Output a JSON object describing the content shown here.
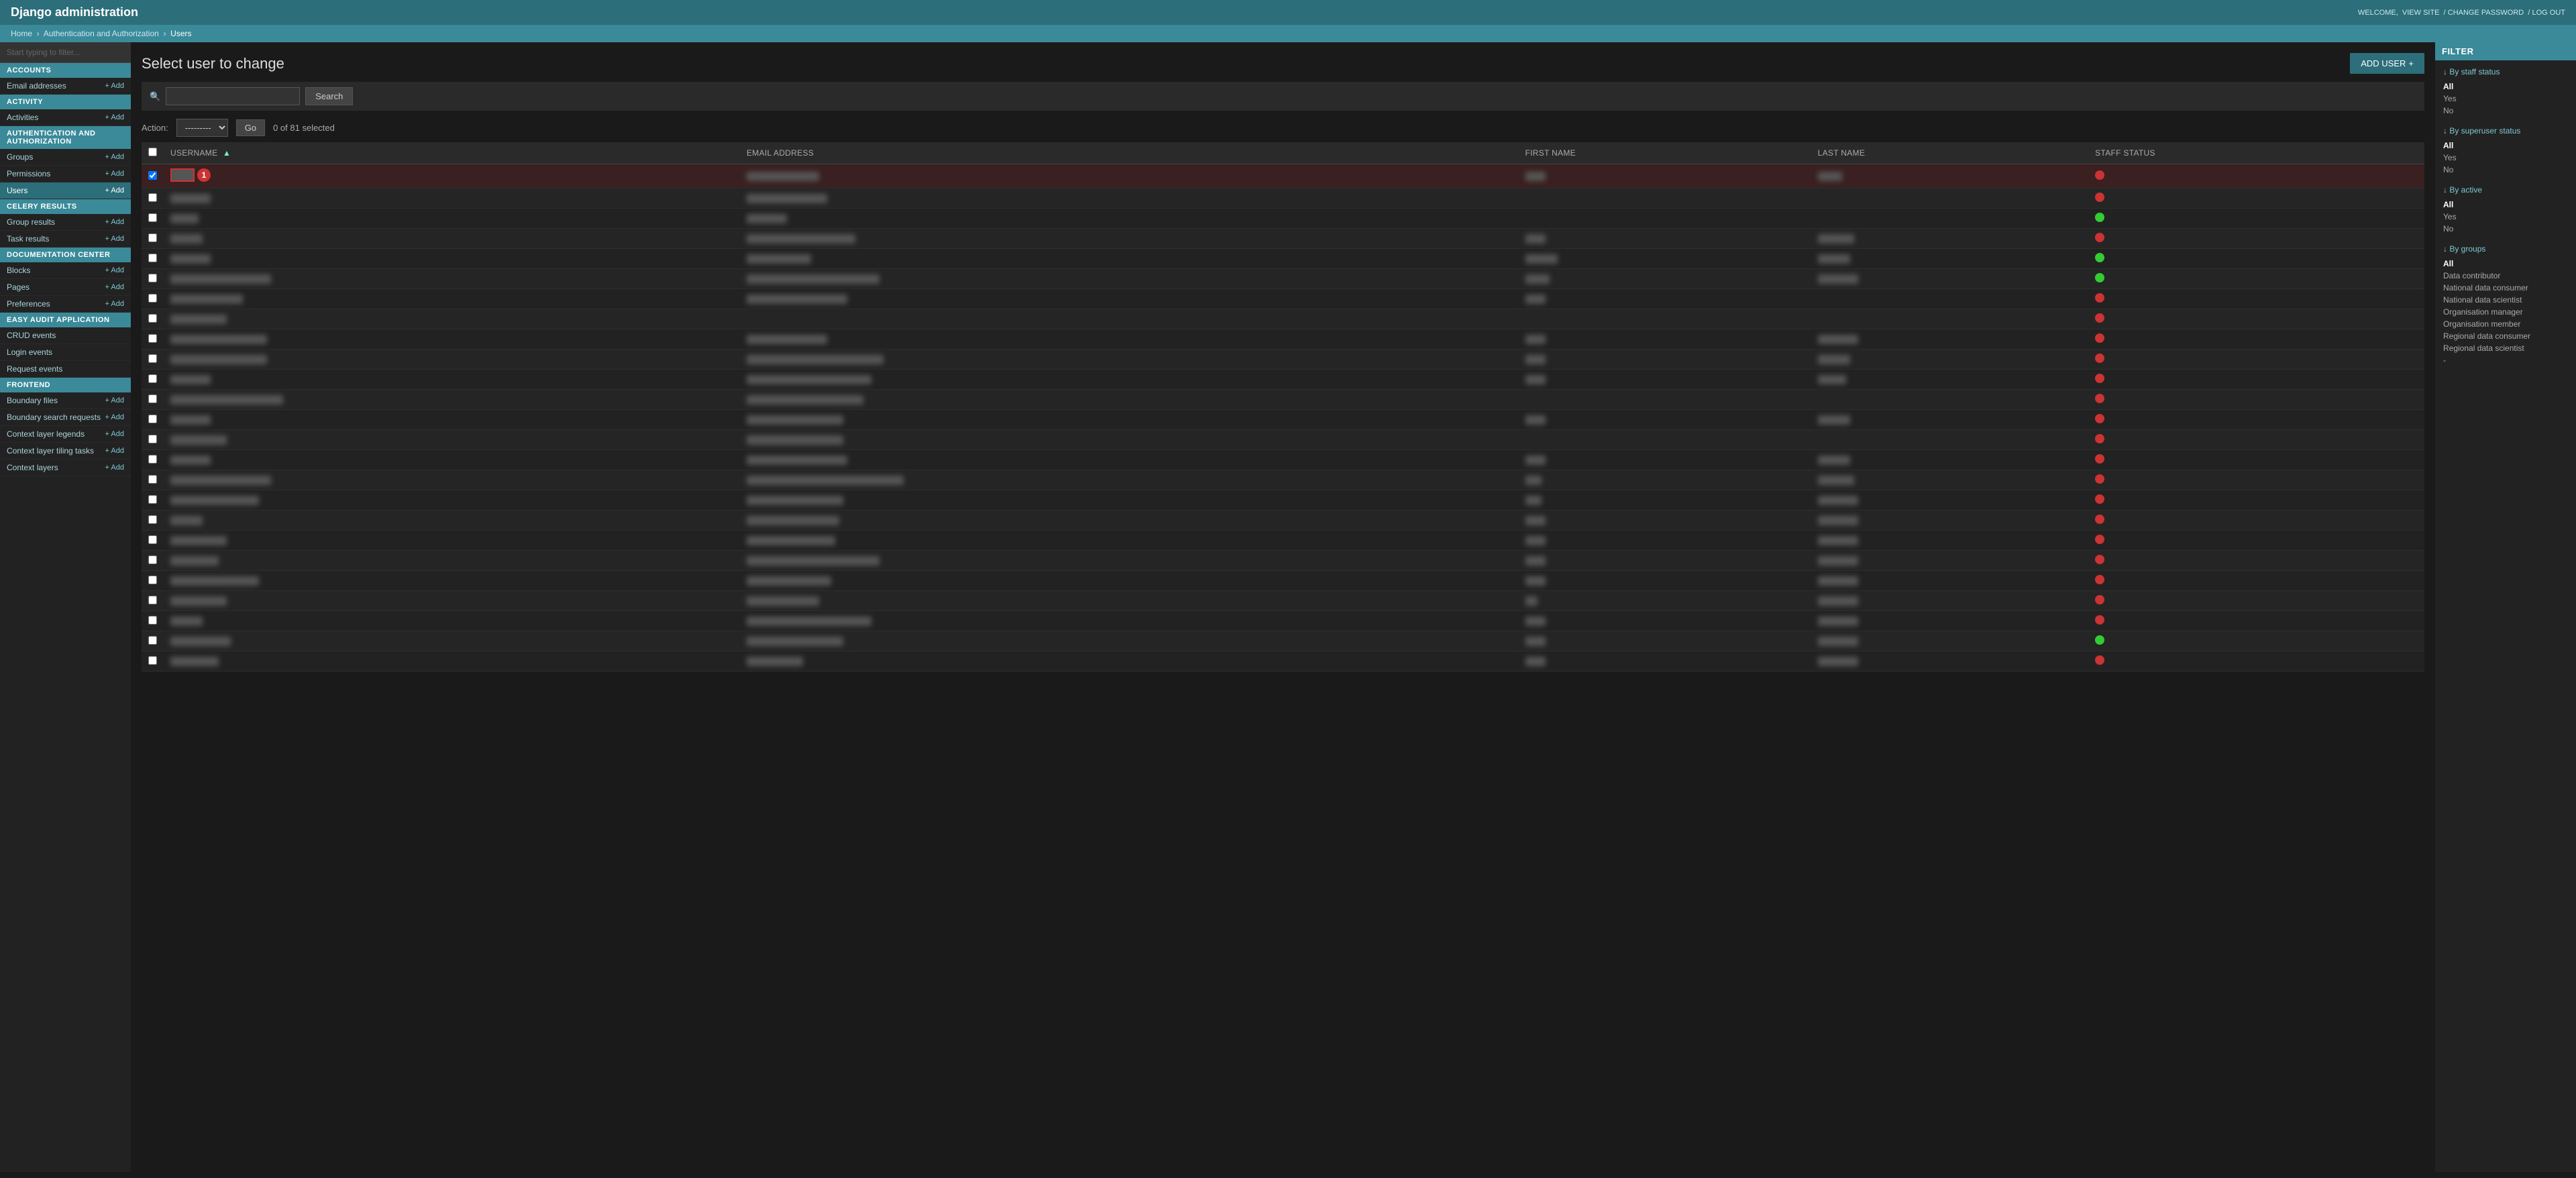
{
  "header": {
    "title": "Django administration",
    "welcome_text": "WELCOME,",
    "username": "",
    "view_site": "VIEW SITE",
    "change_password": "CHANGE PASSWORD",
    "log_out": "LOG OUT"
  },
  "breadcrumb": {
    "home": "Home",
    "section": "Authentication and Authorization",
    "current": "Users"
  },
  "sidebar": {
    "filter_placeholder": "Start typing to filter...",
    "sections": [
      {
        "name": "ACCOUNTS",
        "items": [
          {
            "label": "Email addresses",
            "add": true
          }
        ]
      },
      {
        "name": "ACTIVITY",
        "items": [
          {
            "label": "Activities",
            "add": true
          }
        ]
      },
      {
        "name": "AUTHENTICATION AND AUTHORIZATION",
        "items": [
          {
            "label": "Groups",
            "add": true
          },
          {
            "label": "Permissions",
            "add": true
          },
          {
            "label": "Users",
            "add": true,
            "active": true
          }
        ]
      },
      {
        "name": "CELERY RESULTS",
        "items": [
          {
            "label": "Group results",
            "add": true
          },
          {
            "label": "Task results",
            "add": true
          }
        ]
      },
      {
        "name": "DOCUMENTATION CENTER",
        "items": [
          {
            "label": "Blocks",
            "add": true
          },
          {
            "label": "Pages",
            "add": true
          },
          {
            "label": "Preferences",
            "add": true
          }
        ]
      },
      {
        "name": "EASY AUDIT APPLICATION",
        "items": [
          {
            "label": "CRUD events",
            "add": false
          },
          {
            "label": "Login events",
            "add": false
          },
          {
            "label": "Request events",
            "add": false
          }
        ]
      },
      {
        "name": "FRONTEND",
        "items": [
          {
            "label": "Boundary files",
            "add": true
          },
          {
            "label": "Boundary search requests",
            "add": true
          },
          {
            "label": "Context layer legends",
            "add": true
          },
          {
            "label": "Context layer tiling tasks",
            "add": true
          },
          {
            "label": "Context layers",
            "add": true
          }
        ]
      }
    ]
  },
  "page": {
    "title": "Select user to change",
    "add_user_label": "ADD USER",
    "add_user_icon": "+",
    "search_placeholder": "",
    "search_button": "Search",
    "action_label": "Action:",
    "action_placeholder": "---------",
    "go_button": "Go",
    "selected_info": "0 of 81 selected"
  },
  "table": {
    "columns": [
      {
        "label": "USERNAME",
        "sortable": true
      },
      {
        "label": "EMAIL ADDRESS",
        "sortable": false
      },
      {
        "label": "FIRST NAME",
        "sortable": false
      },
      {
        "label": "LAST NAME",
        "sortable": false
      },
      {
        "label": "STAFF STATUS",
        "sortable": false
      }
    ],
    "rows": [
      {
        "username": "xxxxxxxxxxxxxxx",
        "email": "xxxxxxxxxxxxxxxxxx",
        "first_name": "xxxxx",
        "last_name": "xxxxxx",
        "staff_status": "red",
        "selected": true
      },
      {
        "username": "xxxxxxxxxx",
        "email": "xxxxxxxxxxxxxxxxxxxx",
        "first_name": "",
        "last_name": "",
        "staff_status": "red",
        "selected": false
      },
      {
        "username": "xxxxxxx",
        "email": "xxxxxxxxxx",
        "first_name": "",
        "last_name": "",
        "staff_status": "green",
        "selected": false
      },
      {
        "username": "xxxxxxxx",
        "email": "xxxxxxxxxxxxxxxxxxxxxxxxxxx",
        "first_name": "xxxxx",
        "last_name": "xxxxxxxxx",
        "staff_status": "red",
        "selected": false
      },
      {
        "username": "xxxxxxxxxx",
        "email": "xxxxxxxxxxxxxxxx",
        "first_name": "xxxxxxxx",
        "last_name": "xxxxxxxx",
        "staff_status": "green",
        "selected": false
      },
      {
        "username": "xxxxxxxxxxxxxxxxxxxxxxxxx",
        "email": "xxxxxxxxxxxxxxxxxxxxxxxxxxxxxxxxx",
        "first_name": "xxxxxx",
        "last_name": "xxxxxxxxxx",
        "staff_status": "green",
        "selected": false
      },
      {
        "username": "xxxxxxxxxxxxxxxxxx",
        "email": "xxxxxxxxxxxxxxxxxxxxxxxxx",
        "first_name": "xxxxx",
        "last_name": "",
        "staff_status": "red",
        "selected": false
      },
      {
        "username": "xxxxxxxxxxxxxx",
        "email": "",
        "first_name": "",
        "last_name": "",
        "staff_status": "red",
        "selected": false
      },
      {
        "username": "xxxxxxxxxxxxxxxxxxxxxxxx",
        "email": "xxxxxxxxxxxxxxxxxxxx",
        "first_name": "xxxxx",
        "last_name": "xxxxxxxxxx",
        "staff_status": "red",
        "selected": false
      },
      {
        "username": "xxxxxxxxxxxxxxxxxxxxxxxx",
        "email": "xxxxxxxxxxxxxxxxxxxxxxxxxxxxxxxxxx",
        "first_name": "xxxxx",
        "last_name": "xxxxxxxx",
        "staff_status": "red",
        "selected": false
      },
      {
        "username": "xxxxxxxxxx",
        "email": "xxxxxxxxxxxxxxxxxxxxxxxxxxxxxxx",
        "first_name": "xxxxx",
        "last_name": "xxxxxxx",
        "staff_status": "red",
        "selected": false
      },
      {
        "username": "xxxxxxxxxxxxxxxxxxxxxxxxxxxx",
        "email": "xxxxxxxxxxxxxxxxxxxxxxxxxxxxx",
        "first_name": "",
        "last_name": "",
        "staff_status": "red",
        "selected": false
      },
      {
        "username": "xxxxxxxxxx",
        "email": "xxxxxxxxxxxxxxxxxxxxxxxx",
        "first_name": "xxxxx",
        "last_name": "xxxxxxxx",
        "staff_status": "red",
        "selected": false
      },
      {
        "username": "xxxxxxxxxxxxxx",
        "email": "xxxxxxxxxxxxxxxxxxxxxxxx",
        "first_name": "",
        "last_name": "",
        "staff_status": "red",
        "selected": false
      },
      {
        "username": "xxxxxxxxxx",
        "email": "xxxxxxxxxxxxxxxxxxxxxxxxx",
        "first_name": "xxxxx",
        "last_name": "xxxxxxxx",
        "staff_status": "red",
        "selected": false
      },
      {
        "username": "xxxxxxxxxxxxxxxxxxxxxxxxx",
        "email": "xxxxxxxxxxxxxxxxxxxxxxxxxxxxxxxxxxxxxxx",
        "first_name": "xxxx",
        "last_name": "xxxxxxxxx",
        "staff_status": "red",
        "selected": false
      },
      {
        "username": "xxxxxxxxxxxxxxxxxxxxxx",
        "email": "xxxxxxxxxxxxxxxxxxxxxxxx",
        "first_name": "xxxx",
        "last_name": "xxxxxxxxxx",
        "staff_status": "red",
        "selected": false
      },
      {
        "username": "xxxxxxxx",
        "email": "xxxxxxxxxxxxxxxxxxxxxxx",
        "first_name": "xxxxx",
        "last_name": "xxxxxxxxxx",
        "staff_status": "red",
        "selected": false
      },
      {
        "username": "xxxxxxxxxxxxxx",
        "email": "xxxxxxxxxxxxxxxxxxxxxx",
        "first_name": "xxxxx",
        "last_name": "xxxxxxxxxx",
        "staff_status": "red",
        "selected": false
      },
      {
        "username": "xxxxxxxxxxxx",
        "email": "xxxxxxxxxxxxxxxxxxxxxxxxxxxxxxxxx",
        "first_name": "xxxxx",
        "last_name": "xxxxxxxxxx",
        "staff_status": "red",
        "selected": false
      },
      {
        "username": "xxxxxxxxxxxxxxxxxxxxxx",
        "email": "xxxxxxxxxxxxxxxxxxxxx",
        "first_name": "xxxxx",
        "last_name": "xxxxxxxxxx",
        "staff_status": "red",
        "selected": false
      },
      {
        "username": "xxxxxxxxxxxxxx",
        "email": "xxxxxxxxxxxxxxxxxx",
        "first_name": "xxx",
        "last_name": "xxxxxxxxxx",
        "staff_status": "red",
        "selected": false
      },
      {
        "username": "xxxxxxxx",
        "email": "xxxxxxxxxxxxxxxxxxxxxxxxxxxxxxx",
        "first_name": "xxxxx",
        "last_name": "xxxxxxxxxx",
        "staff_status": "red",
        "selected": false
      },
      {
        "username": "xxxxxxxxxxxxxxx",
        "email": "xxxxxxxxxxxxxxxxxxxxxxxx",
        "first_name": "xxxxx",
        "last_name": "xxxxxxxxxx",
        "staff_status": "green",
        "selected": false
      },
      {
        "username": "xxxxxxxxxxxx",
        "email": "xxxxxxxxxxxxxx",
        "first_name": "xxxxx",
        "last_name": "xxxxxxxxxx",
        "staff_status": "red",
        "selected": false
      }
    ]
  },
  "filter_panel": {
    "title": "FILTER",
    "sections": [
      {
        "title": "↓ By staff status",
        "items": [
          {
            "label": "All",
            "active": true
          },
          {
            "label": "Yes",
            "active": false
          },
          {
            "label": "No",
            "active": false
          }
        ]
      },
      {
        "title": "↓ By superuser status",
        "items": [
          {
            "label": "All",
            "active": true
          },
          {
            "label": "Yes",
            "active": false
          },
          {
            "label": "No",
            "active": false
          }
        ]
      },
      {
        "title": "↓ By active",
        "items": [
          {
            "label": "All",
            "active": true
          },
          {
            "label": "Yes",
            "active": false
          },
          {
            "label": "No",
            "active": false
          }
        ]
      },
      {
        "title": "↓ By groups",
        "items": [
          {
            "label": "All",
            "active": true
          },
          {
            "label": "Data contributor",
            "active": false
          },
          {
            "label": "National data consumer",
            "active": false
          },
          {
            "label": "National data scientist",
            "active": false
          },
          {
            "label": "Organisation manager",
            "active": false
          },
          {
            "label": "Organisation member",
            "active": false
          },
          {
            "label": "Regional data consumer",
            "active": false
          },
          {
            "label": "Regional data scientist",
            "active": false
          },
          {
            "label": "-",
            "active": false
          }
        ]
      }
    ]
  }
}
